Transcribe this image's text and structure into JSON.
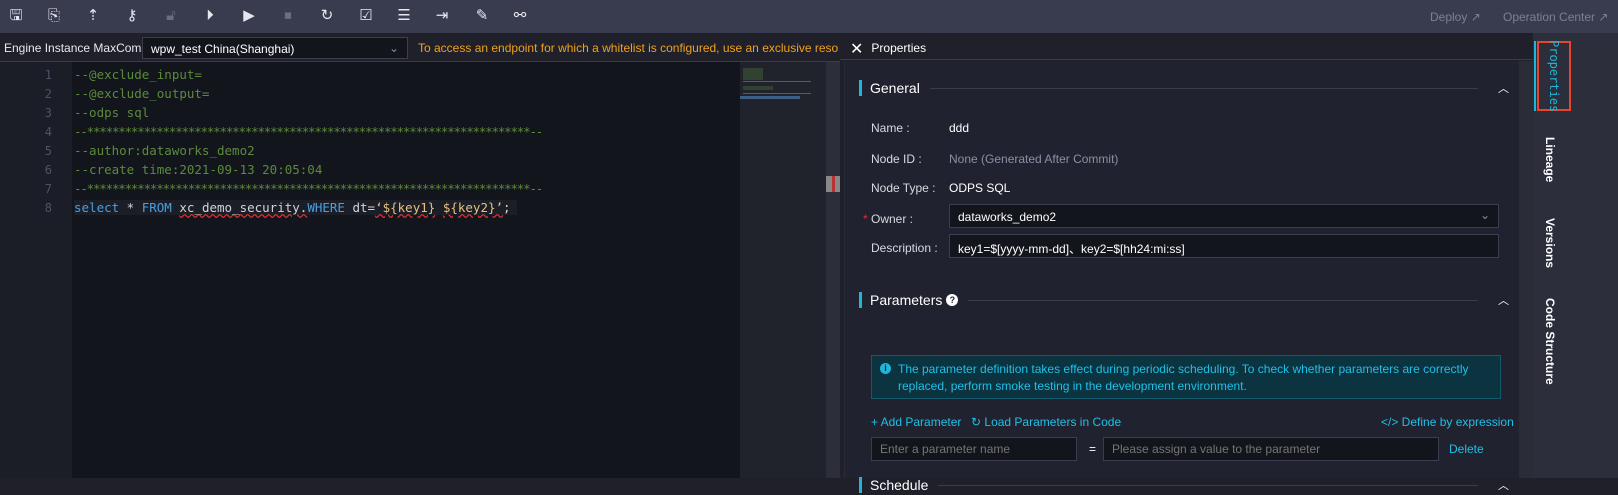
{
  "toolbar": {
    "icons": [
      "save-icon",
      "save-as-icon",
      "submit-icon",
      "steal-lock-icon",
      "unlock-icon",
      "run-icon",
      "run-with-params-icon",
      "stop-icon",
      "reload-icon",
      "format-icon",
      "properties-icon",
      "export-icon",
      "tools-icon",
      "lineage-icon"
    ],
    "deploy": "Deploy ↗",
    "operation_center": "Operation Center ↗"
  },
  "engine": {
    "label": "Engine Instance MaxCompute:",
    "value": "wpw_test China(Shanghai)",
    "warning": "To access an endpoint for which a whitelist is configured, use an exclusive resou"
  },
  "editor": {
    "lines": [
      "--@exclude_input=",
      "--@exclude_output=",
      "--odps sql",
      "--**********************************************************************--",
      "--author:dataworks_demo2",
      "--create time:2021-09-13 20:05:04",
      "--**********************************************************************--"
    ],
    "line8": {
      "k1": "select",
      "s1": " * ",
      "k2": "FROM",
      "s2": " ",
      "t1": "xc_demo_security.",
      "k3": "WHERE",
      "s3": " dt=",
      "q1": "‘${key1}",
      "s4": " ",
      "q2": "${key2}’",
      "end": ";"
    },
    "numbers": [
      "1",
      "2",
      "3",
      "4",
      "5",
      "6",
      "7",
      "8"
    ]
  },
  "properties": {
    "title": "Properties",
    "general": {
      "title": "General",
      "name_label": "Name :",
      "name": "ddd",
      "nodeid_label": "Node ID :",
      "nodeid": "None (Generated After Commit)",
      "type_label": "Node Type :",
      "type": "ODPS SQL",
      "owner_label": "Owner :",
      "owner": "dataworks_demo2",
      "desc_label": "Description :",
      "desc": "key1=$[yyyy-mm-dd]、key2=$[hh24:mi:ss]"
    },
    "parameters": {
      "title": "Parameters",
      "info": "The parameter definition takes effect during periodic scheduling. To check whether parameters are correctly replaced, perform smoke testing in the development environment.",
      "add": "+ Add Parameter",
      "load": "Load Parameters in Code",
      "define": "</> Define by expression",
      "name_placeholder": "Enter a parameter name",
      "eq": "=",
      "value_placeholder": "Please assign a value to the parameter",
      "delete": "Delete"
    },
    "schedule": {
      "title": "Schedule"
    }
  },
  "right_tabs": [
    "Properties",
    "Lineage",
    "Versions",
    "Code Structure"
  ],
  "colors": {
    "accent": "#1fb6d8",
    "warning": "#f1a11d",
    "highlight_box": "#e8452c"
  }
}
